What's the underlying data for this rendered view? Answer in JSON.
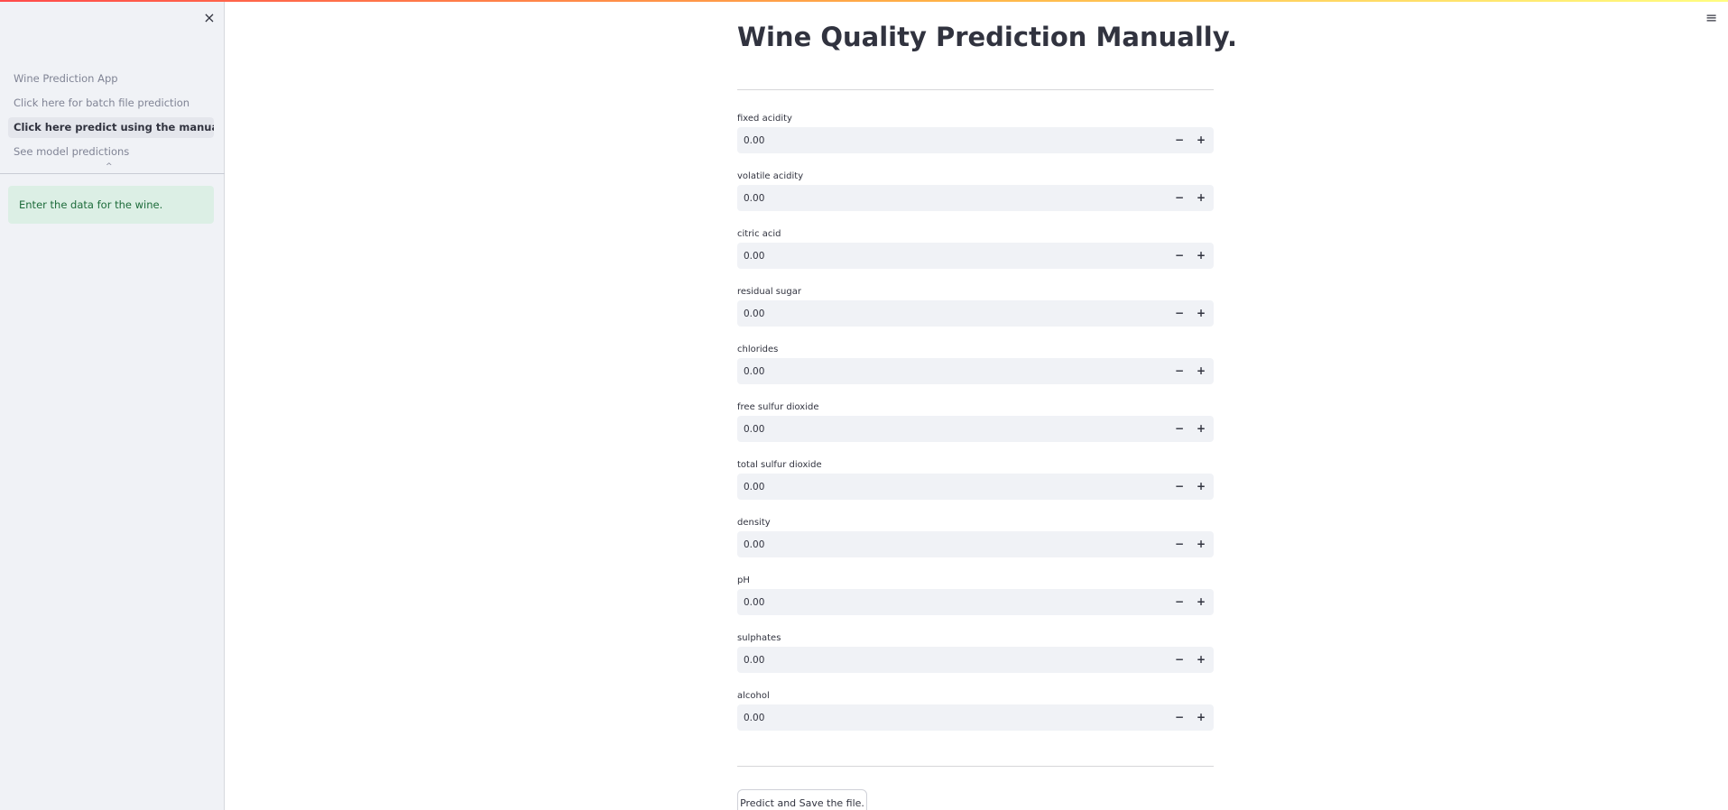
{
  "sidebar": {
    "close_icon": "×",
    "nav_items": [
      {
        "label": "Wine Prediction App",
        "active": false
      },
      {
        "label": "Click here for batch file prediction",
        "active": false
      },
      {
        "label": "Click here predict using the manual entry",
        "active": true
      },
      {
        "label": "See model predictions",
        "active": false
      }
    ],
    "collapse_icon": "^",
    "info_message": "Enter the data for the wine."
  },
  "header": {
    "menu_icon": "≡"
  },
  "main": {
    "title": "Wine Quality Prediction Manually.",
    "fields": [
      {
        "label": "fixed acidity",
        "value": "0.00"
      },
      {
        "label": "volatile acidity",
        "value": "0.00"
      },
      {
        "label": "citric acid",
        "value": "0.00"
      },
      {
        "label": "residual sugar",
        "value": "0.00"
      },
      {
        "label": "chlorides",
        "value": "0.00"
      },
      {
        "label": "free sulfur dioxide",
        "value": "0.00"
      },
      {
        "label": "total sulfur dioxide",
        "value": "0.00"
      },
      {
        "label": "density",
        "value": "0.00"
      },
      {
        "label": "pH",
        "value": "0.00"
      },
      {
        "label": "sulphates",
        "value": "0.00"
      },
      {
        "label": "alcohol",
        "value": "0.00"
      }
    ],
    "stepper": {
      "minus": "−",
      "plus": "+"
    },
    "predict_button": "Predict and Save the file."
  },
  "colors": {
    "sidebar_bg": "#f0f2f6",
    "info_bg": "#dcefe5",
    "info_text": "#1d6b3a",
    "text": "#31333f",
    "muted_text": "#808495"
  }
}
